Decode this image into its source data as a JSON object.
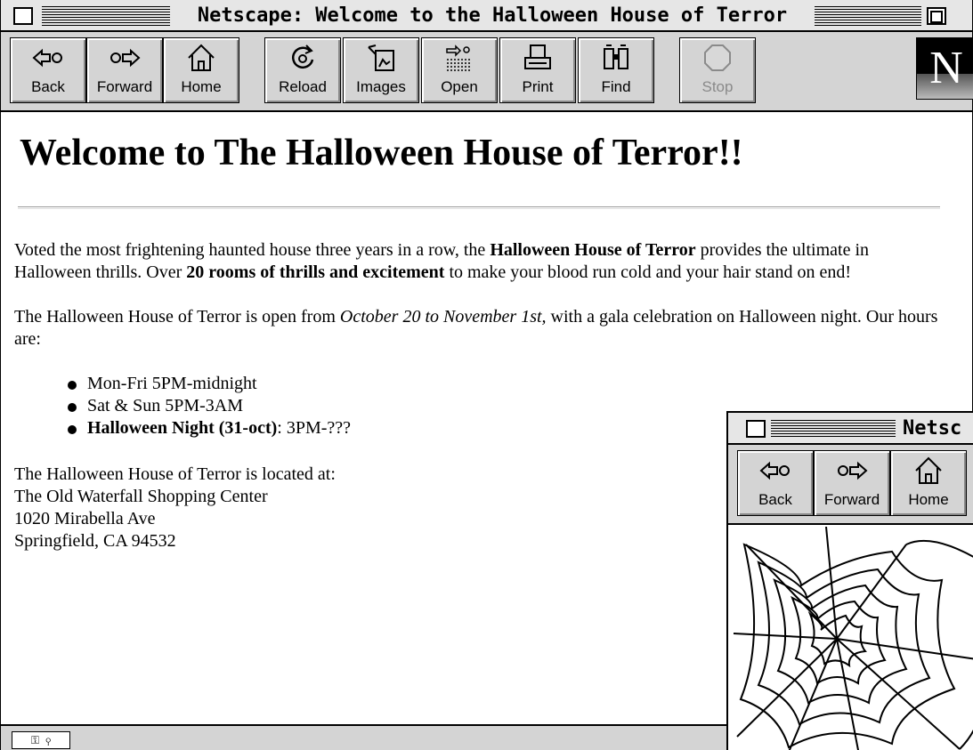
{
  "window": {
    "title": "Netscape: Welcome to the Halloween House of Terror"
  },
  "toolbar": {
    "buttons": [
      {
        "label": "Back",
        "icon": "back-arrow-icon",
        "enabled": true
      },
      {
        "label": "Forward",
        "icon": "forward-arrow-icon",
        "enabled": true
      },
      {
        "label": "Home",
        "icon": "home-icon",
        "enabled": true
      },
      {
        "label": "Reload",
        "icon": "reload-icon",
        "enabled": true
      },
      {
        "label": "Images",
        "icon": "images-icon",
        "enabled": true
      },
      {
        "label": "Open",
        "icon": "open-icon",
        "enabled": true
      },
      {
        "label": "Print",
        "icon": "print-icon",
        "enabled": true
      },
      {
        "label": "Find",
        "icon": "find-binoculars-icon",
        "enabled": true
      },
      {
        "label": "Stop",
        "icon": "stop-icon",
        "enabled": false
      }
    ],
    "logo_letter": "N"
  },
  "page": {
    "heading": "Welcome to The Halloween House of Terror!!",
    "intro": {
      "t1": "Voted the most frightening haunted house three years in a row, the ",
      "b1": "Halloween House of Terror",
      "t2": " provides the ultimate in Halloween thrills. Over ",
      "b2": "20 rooms of thrills and excitement",
      "t3": " to make your blood run cold and your hair stand on end!"
    },
    "dates": {
      "t1": "The Halloween House of Terror is open from ",
      "i1": "October 20 to November 1st,",
      "t2": " with a gala celebration on Halloween night. Our hours are:"
    },
    "hours": {
      "weekday": "Mon-Fri 5PM-midnight",
      "weekend": "Sat & Sun 5PM-3AM",
      "halloween_label": "Halloween Night (31-oct)",
      "halloween_hours": ": 3PM-???"
    },
    "address": {
      "intro": "The Halloween House of Terror is located at:",
      "line1": "The Old Waterfall Shopping Center",
      "line2": "1020 Mirabella Ave",
      "line3": "Springfield, CA 94532"
    }
  },
  "second_window": {
    "title": "Netsc",
    "buttons": [
      {
        "label": "Back",
        "icon": "back-arrow-icon"
      },
      {
        "label": "Forward",
        "icon": "forward-arrow-icon"
      },
      {
        "label": "Home",
        "icon": "home-icon"
      }
    ],
    "image": "spider-web-image"
  }
}
